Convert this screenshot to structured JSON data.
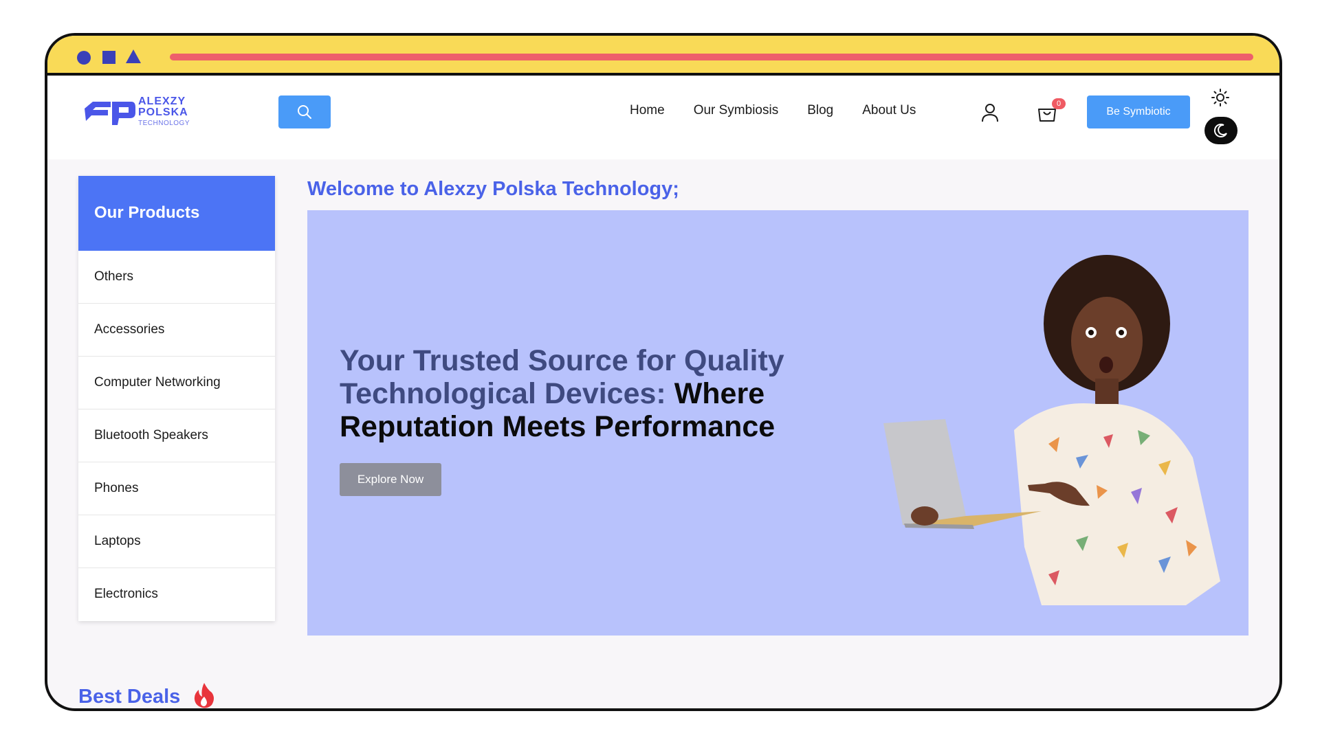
{
  "chrome": {
    "controls": [
      "circle",
      "square",
      "triangle"
    ],
    "accent_colors": {
      "bar": "#ee5f6b",
      "background": "#f9da57",
      "shapes": "#3a40b8"
    }
  },
  "header": {
    "logo": {
      "line1": "ALEXZY",
      "line2": "POLSKA",
      "line3": "TECHNOLOGY"
    },
    "search_icon": "search-icon",
    "nav": [
      "Home",
      "Our Symbiosis",
      "Blog",
      "About Us"
    ],
    "user_icon": "user-icon",
    "cart": {
      "icon": "cart-icon",
      "count": "0"
    },
    "cta_label": "Be Symbiotic",
    "theme_toggle": {
      "light_icon": "sun-icon",
      "dark_icon": "moon-icon"
    }
  },
  "sidebar": {
    "title": "Our Products",
    "items": [
      "Others",
      "Accessories",
      "Computer Networking",
      "Bluetooth Speakers",
      "Phones",
      "Laptops",
      "Electronics"
    ]
  },
  "main": {
    "welcome": "Welcome to Alexzy Polska Technology;",
    "hero": {
      "title_part1": "Your Trusted Source for Quality Technological Devices:",
      "title_part2": "Where Reputation Meets Performance",
      "button_label": "Explore Now"
    }
  },
  "deals": {
    "title": "Best Deals",
    "icon": "fire-icon"
  },
  "colors": {
    "primary": "#4a9bf8",
    "sidebar_head": "#4c74f5",
    "hero_bg": "#b8c2fc",
    "heading_blue": "#4a62e8"
  }
}
